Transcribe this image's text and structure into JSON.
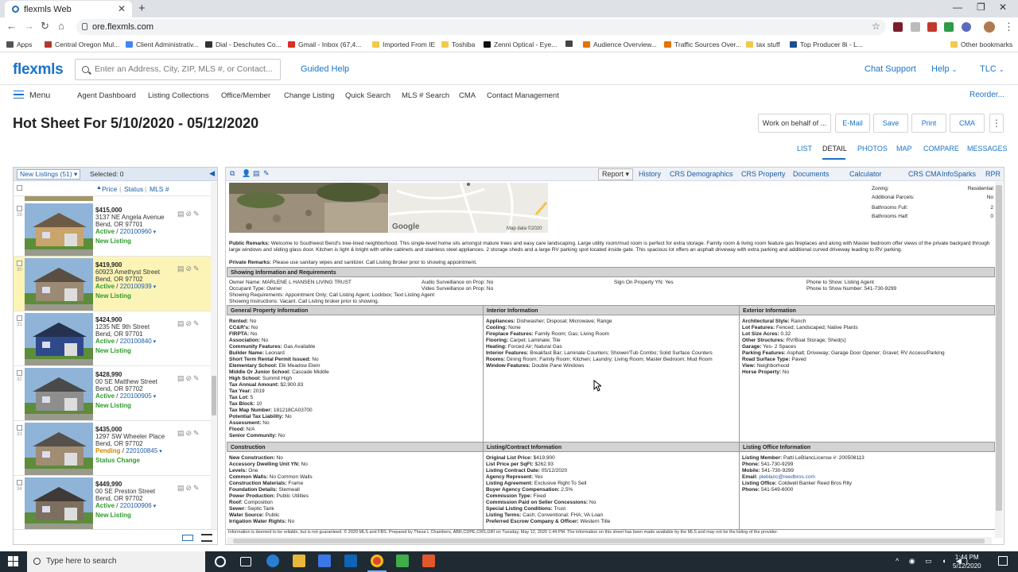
{
  "browser": {
    "tab_title": "flexmls Web",
    "url": "ore.flexmls.com"
  },
  "bookmarks": [
    {
      "label": "Apps",
      "color": "#555"
    },
    {
      "label": "Central Oregon Mul...",
      "color": "#b03a2e"
    },
    {
      "label": "Client Administrativ...",
      "color": "#4285f4"
    },
    {
      "label": "Dial - Deschutes Co...",
      "color": "#333"
    },
    {
      "label": "Gmail - Inbox (67,4...",
      "color": "#d93025"
    },
    {
      "label": "Imported From IE",
      "color": "#f2c94c"
    },
    {
      "label": "Toshiba",
      "color": "#f2c94c"
    },
    {
      "label": "Zenni Optical - Eye...",
      "color": "#111"
    },
    {
      "label": "",
      "color": "#444"
    },
    {
      "label": "Audience Overview...",
      "color": "#e37400"
    },
    {
      "label": "Traffic Sources Over...",
      "color": "#e37400"
    },
    {
      "label": "tax stuff",
      "color": "#f2c94c"
    },
    {
      "label": "Top Producer 8i - L...",
      "color": "#1a4f8f"
    },
    {
      "label": "Other bookmarks",
      "color": "#f2c94c"
    }
  ],
  "header": {
    "logo": "flexmls",
    "search_placeholder": "Enter an Address, City, ZIP, MLS #, or Contact...",
    "guided_help": "Guided Help",
    "chat_support": "Chat Support",
    "help": "Help",
    "user": "TLC"
  },
  "menu": {
    "menu_label": "Menu",
    "items": [
      "Agent Dashboard",
      "Listing Collections",
      "Office/Member",
      "Change Listing",
      "Quick Search",
      "MLS # Search",
      "CMA",
      "Contact Management"
    ],
    "reorder": "Reorder..."
  },
  "page": {
    "title": "Hot Sheet For 5/10/2020 - 05/12/2020",
    "buttons": [
      "Work on behalf of ...",
      "E-Mail",
      "Save",
      "Print",
      "CMA"
    ],
    "view_tabs": [
      "LIST",
      "DETAIL",
      "PHOTOS",
      "MAP",
      "COMPARE",
      "MESSAGES"
    ],
    "active_view": "DETAIL"
  },
  "left_panel": {
    "list_name": "New Listings (51)",
    "selected": "Selected: 0",
    "sort_price": "Price",
    "sort_status": "Status",
    "sort_mls": "MLS #",
    "listings": [
      {
        "num": "29",
        "price": "$415,000",
        "addr1": "3137 NE Angela Avenue",
        "addr2": "Bend, OR 97701",
        "status": "Active",
        "mls": "220100960",
        "change": "New Listing",
        "house": "#c9a46b",
        "roof": "#6d5a45",
        "highlight": false,
        "pending": false
      },
      {
        "num": "30",
        "price": "$419,900",
        "addr1": "60923 Amethyst Street",
        "addr2": "Bend, OR 97702",
        "status": "Active",
        "mls": "220100939",
        "change": "New Listing",
        "house": "#9b8a74",
        "roof": "#5a4e42",
        "highlight": true,
        "pending": false
      },
      {
        "num": "31",
        "price": "$424,900",
        "addr1": "1235 NE 9th Street",
        "addr2": "Bend, OR 97701",
        "status": "Active",
        "mls": "220100840",
        "change": "New Listing",
        "house": "#2f4a8a",
        "roof": "#24324f",
        "highlight": false,
        "pending": false
      },
      {
        "num": "32",
        "price": "$428,990",
        "addr1": "00 SE Matthew Street",
        "addr2": "Bend, OR 97702",
        "status": "Active",
        "mls": "220100905",
        "change": "New Listing",
        "house": "#8e8e8e",
        "roof": "#4a4a4a",
        "highlight": false,
        "pending": false
      },
      {
        "num": "33",
        "price": "$435,000",
        "addr1": "1297 SW Wheeler Place",
        "addr2": "Bend, OR 97702",
        "status": "Pending",
        "mls": "220100845",
        "change": "Status Change",
        "house": "#a18c74",
        "roof": "#55504a",
        "highlight": false,
        "pending": true
      },
      {
        "num": "34",
        "price": "$449,990",
        "addr1": "00 SE Preston Street",
        "addr2": "Bend, OR 97702",
        "status": "Active",
        "mls": "220100906",
        "change": "New Listing",
        "house": "#7d6f60",
        "roof": "#3f3a35",
        "highlight": false,
        "pending": false
      }
    ]
  },
  "detail_toolbar": {
    "report": "Report",
    "links": [
      "History",
      "CRS Demographics",
      "CRS Property",
      "Documents",
      "Calculator",
      "CRS CMA",
      "InfoSparks",
      "RPR"
    ]
  },
  "detail": {
    "map_credit": "Map data ©2020",
    "map_logo": "Google",
    "zoning_label": "Zoning:",
    "zoning": "Residential",
    "add_parcels_label": "Additional Parcels:",
    "add_parcels": "No",
    "baths_full_label": "Bathrooms Full:",
    "baths_full": "2",
    "baths_half_label": "Bathrooms Half:",
    "baths_half": "0",
    "remarks_label": "Public Remarks:",
    "remarks": "Welcome to Southwest Bend's tree-lined neighborhood. This single-level home sits amongst mature trees and easy care landscaping. Large utility room/mud room is perfect for extra storage. Family room & living room feature gas fireplaces and along with Master bedroom offer views of the private backyard through large windows and sliding glass door. Kitchen is light & bright with white cabinets and stainless steel appliances. 2 storage sheds and a large RV parking spot located inside gate. This spacious lot offers an asphalt driveway with extra parking and additional curved driveway leading to RV parking.",
    "private_label": "Private Remarks:",
    "private": "Please use sanitary wipes and sanitizer. Call Listing Broker prior to showing appointment.",
    "showing_header": "Showing Information and Requirements",
    "owner_name": "Owner Name: MARLENE L HANSEN LIVING TRUST",
    "occupant": "Occupant Type: Owner",
    "show_req": "Showing Requirements: Appointment Only; Call Listing Agent; Lockbox; Text Listing Agent",
    "show_instr": "Showing Instructions: Vacant. Call Listing broker prior to showing.",
    "audio": "Audio Surveillance on Prop: No",
    "video": "Video Surveillance on Prop: No",
    "sign": "Sign On Property YN: Yes",
    "phone_show": "Phone to Show: Listing Agent",
    "phone_num": "Phone to Show Number: 541-730-9299",
    "gen_header": "General Property Information",
    "int_header": "Interior Information",
    "ext_header": "Exterior Information",
    "general": [
      "Rented: No",
      "CC&R's: No",
      "FIRPTA: No",
      "Association: No",
      "Community Features: Gas Available",
      "Builder Name: Leonard",
      "Short Term Rental Permit Issued: No",
      "Elementary School: Elk Meadow Elem",
      "Middle Or Junior School: Cascade Middle",
      "High School: Summit High",
      "Tax Annual Amount: $2,900.83",
      "Tax Year: 2019",
      "Tax Lot: 5",
      "Tax Block: 10",
      "Tax Map Number: 181218CA03700",
      "Potential Tax Liability: No",
      "Assessment: No",
      "Flood: N/A",
      "Senior Community: No"
    ],
    "interior": [
      "Appliances: Dishwasher; Disposal; Microwave; Range",
      "Cooling: None",
      "Fireplace Features: Family Room; Gas; Living Room",
      "Flooring: Carpet; Laminate; Tile",
      "Heating: Forced Air; Natural Gas",
      "Interior Features: Breakfast Bar; Laminate Counters; Shower/Tub Combo; Solid Surface Counters",
      "Rooms: Dining Room; Family Room; Kitchen; Laundry; Living Room; Master Bedroom; Mud Room",
      "Window Features: Double Pane Windows"
    ],
    "exterior": [
      "Architectural Style: Ranch",
      "Lot Features: Fenced; Landscaped; Native Plants",
      "Lot Size Acres: 0.32",
      "Other Structures: RV/Boat Storage; Shed(s)",
      "Garage: Yes- 2 Spaces",
      "Parking Features: Asphalt; Driveway; Garage Door Opener; Gravel; RV Access/Parking",
      "Road Surface Type: Paved",
      "View: Neighborhood",
      "Horse Property: No"
    ],
    "con_header": "Construction",
    "lc_header": "Listing/Contract Information",
    "lo_header": "Listing Office Information",
    "construction": [
      "New Construction: No",
      "Accessory Dwelling Unit YN: No",
      "Levels: One",
      "Common Walls: No Common Walls",
      "Construction Materials: Frame",
      "Foundation Details: Stemwall",
      "Power Production: Public Utilities",
      "Roof: Composition",
      "Sewer: Septic Tank",
      "Water Source: Public",
      "Irrigation Water Rights: No"
    ],
    "listing": [
      "Original List Price: $419,900",
      "List Price per SqFt: $262.93",
      "Listing Contract Date: 05/12/2020",
      "Agency Represent: Yes",
      "Listing Agreement: Exclusive Right To Sell",
      "Buyer Agency Compensation: 2.5%",
      "Commission Type: Fixed",
      "Commission Paid on Seller Concessions: No",
      "Special Listing Conditions: Trust",
      "Listing Terms: Cash; Conventional; FHA; VA Loan",
      "Preferred Escrow Company & Officer: Western Title"
    ],
    "office": [
      "Listing Member: Patti LeBlancLicense #: 200508113",
      "Phone: 541-730-9299",
      "Mobile: 541-730-9299",
      "Email: pleblanc@reedbros.com",
      "Listing Office: Coldwell Banker Reed Bros Rlty",
      "Phone: 541-549-6000"
    ],
    "footer": "Information is deemed to be reliable, but is not guaranteed. © 2020 MLS and FBS. Prepared by Thesa L Chambers, ABR,CDPE,CRS,GRI on Tuesday, May 12, 2020 1:44 PM. The information on this sheet has been made available by the MLS and may not be the listing of the provider."
  },
  "taskbar": {
    "search": "Type here to search",
    "time": "1:44 PM",
    "date": "5/12/2020"
  }
}
